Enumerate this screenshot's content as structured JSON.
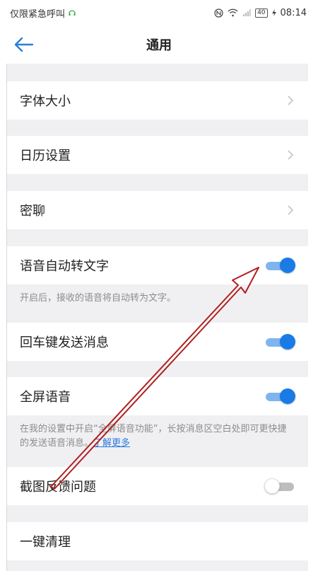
{
  "status_bar": {
    "carrier": "仅限紧急呼叫",
    "battery": "40",
    "time": "08:14"
  },
  "header": {
    "title": "通用"
  },
  "rows": {
    "font_size": "字体大小",
    "calendar": "日历设置",
    "secret_chat": "密聊",
    "voice_to_text": {
      "label": "语音自动转文字",
      "enabled": true
    },
    "voice_to_text_note": "开启后，接收的语音将自动转为文字。",
    "enter_send": {
      "label": "回车键发送消息",
      "enabled": true
    },
    "fullscreen_voice": {
      "label": "全屏语音",
      "enabled": true
    },
    "fullscreen_voice_note": "在我的设置中开启“全屏语音功能”，长按消息区空白处即可更快捷的发送语音消息。",
    "fullscreen_voice_link": "了解更多",
    "screenshot_feedback": {
      "label": "截图反馈问题",
      "enabled": false
    },
    "one_key_clean": "一键清理"
  },
  "colors": {
    "accent": "#1a7ae6",
    "annotation_arrow": "#b02020"
  }
}
